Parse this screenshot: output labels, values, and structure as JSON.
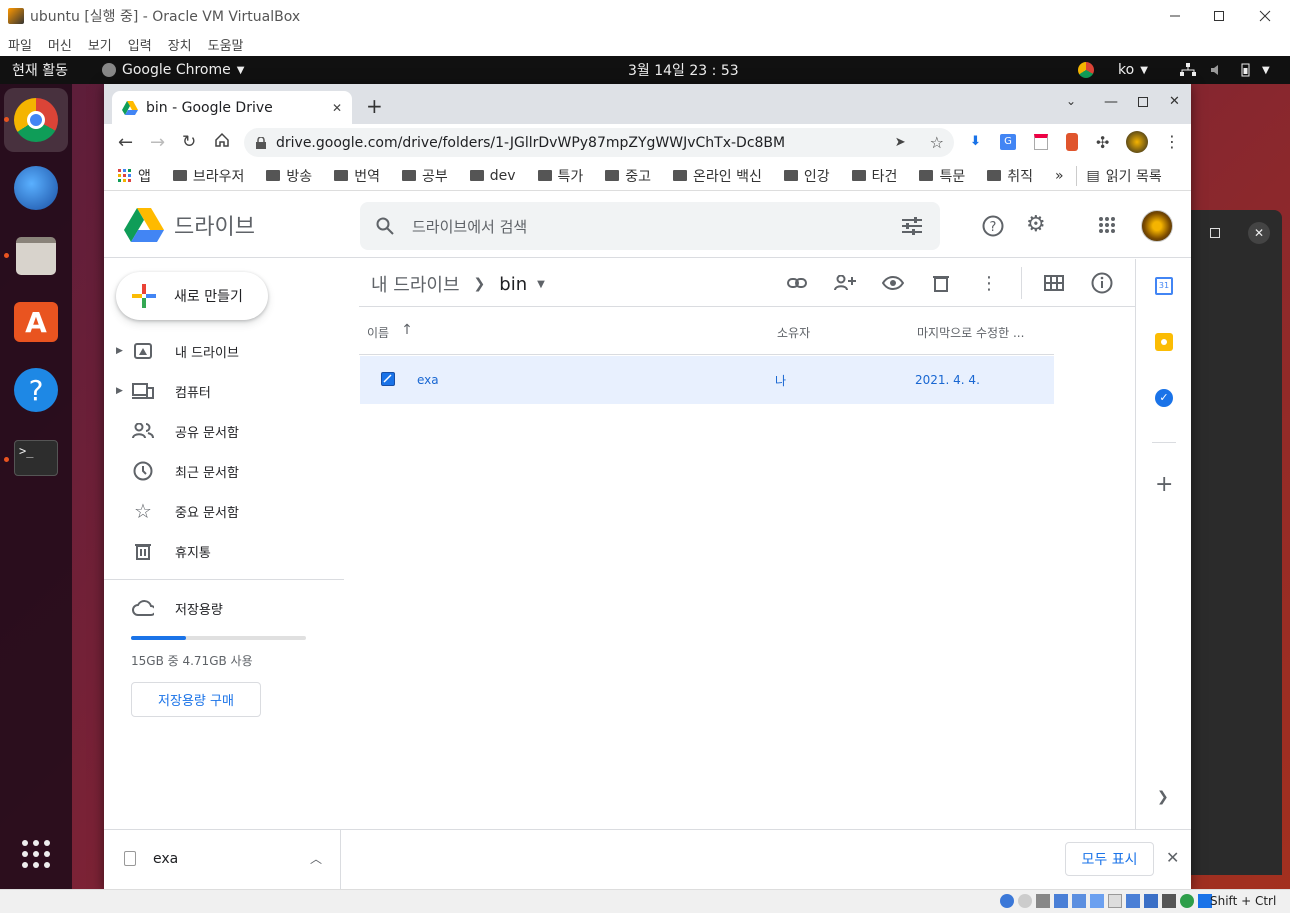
{
  "vbox": {
    "title": "ubuntu [실행 중] - Oracle VM VirtualBox",
    "menu": [
      "파일",
      "머신",
      "보기",
      "입력",
      "장치",
      "도움말"
    ],
    "status_key": "Shift + Ctrl"
  },
  "ubuntu_bar": {
    "activities": "현재 활동",
    "app": "Google Chrome",
    "clock": "3월 14일  23 : 53",
    "lang": "ko"
  },
  "dock": {
    "items": [
      "chrome-icon",
      "thunderbird-icon",
      "files-icon",
      "software-icon",
      "help-icon",
      "terminal-icon"
    ],
    "apps_grid": "show-apps-icon"
  },
  "chrome": {
    "tab_title": "bin - Google Drive",
    "url": "drive.google.com/drive/folders/1-JGllrDvWPy87mpZYgWWJvChTx-Dc8BM",
    "bookmarks": [
      "앱",
      "브라우저",
      "방송",
      "번역",
      "공부",
      "dev",
      "특가",
      "중고",
      "온라인 백신",
      "인강",
      "타건",
      "특문",
      "취직"
    ],
    "bookmarks_more": "»",
    "reading_list": "읽기 목록"
  },
  "drive": {
    "logo_text": "드라이브",
    "search_placeholder": "드라이브에서 검색",
    "new_button": "새로 만들기",
    "nav": [
      {
        "label": "내 드라이브"
      },
      {
        "label": "컴퓨터"
      },
      {
        "label": "공유 문서함"
      },
      {
        "label": "최근 문서함"
      },
      {
        "label": "중요 문서함"
      },
      {
        "label": "휴지통"
      }
    ],
    "storage": {
      "label": "저장용량",
      "usage": "15GB 중 4.71GB 사용",
      "used_fraction": 0.314,
      "buy_button": "저장용량 구매"
    },
    "breadcrumb": {
      "root": "내 드라이브",
      "current": "bin"
    },
    "columns": {
      "name": "이름",
      "owner": "소유자",
      "modified": "마지막으로 수정한 ..."
    },
    "files": [
      {
        "name": "exa",
        "owner": "나",
        "modified": "2021. 4. 4."
      }
    ]
  },
  "download_bar": {
    "file": "exa",
    "show_all": "모두 표시"
  },
  "colors": {
    "drive_blue": "#1967d2",
    "row_selected": "#e8f0fe",
    "ubuntu_orange": "#e95420"
  }
}
